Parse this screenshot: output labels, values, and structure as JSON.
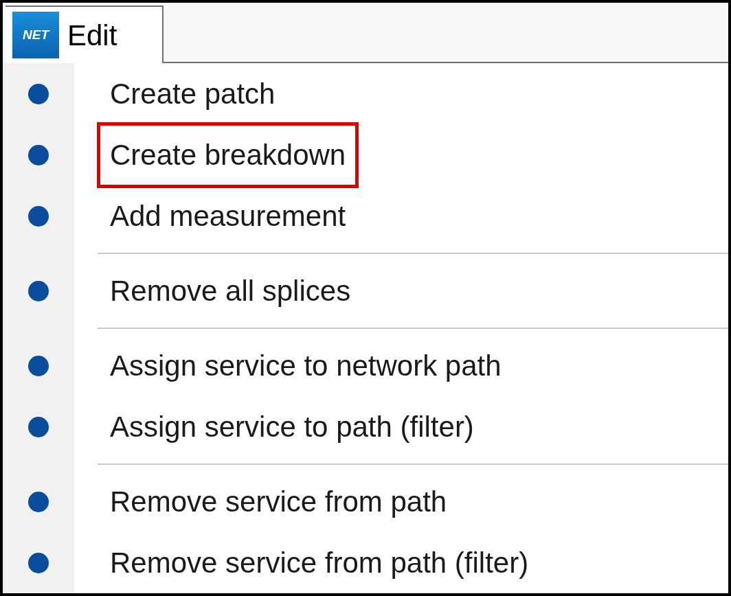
{
  "menu_bar": {
    "logo_text": "NET",
    "title": "Edit"
  },
  "menu": {
    "items": [
      {
        "kind": "item",
        "label": "Create patch",
        "highlighted": false
      },
      {
        "kind": "item",
        "label": "Create breakdown",
        "highlighted": true
      },
      {
        "kind": "item",
        "label": "Add measurement",
        "highlighted": false
      },
      {
        "kind": "separator"
      },
      {
        "kind": "item",
        "label": "Remove all splices",
        "highlighted": false
      },
      {
        "kind": "separator"
      },
      {
        "kind": "item",
        "label": "Assign service to network path",
        "highlighted": false
      },
      {
        "kind": "item",
        "label": "Assign service to path (filter)",
        "highlighted": false
      },
      {
        "kind": "separator"
      },
      {
        "kind": "item",
        "label": "Remove service from path",
        "highlighted": false
      },
      {
        "kind": "item",
        "label": "Remove service from path (filter)",
        "highlighted": false
      }
    ]
  }
}
